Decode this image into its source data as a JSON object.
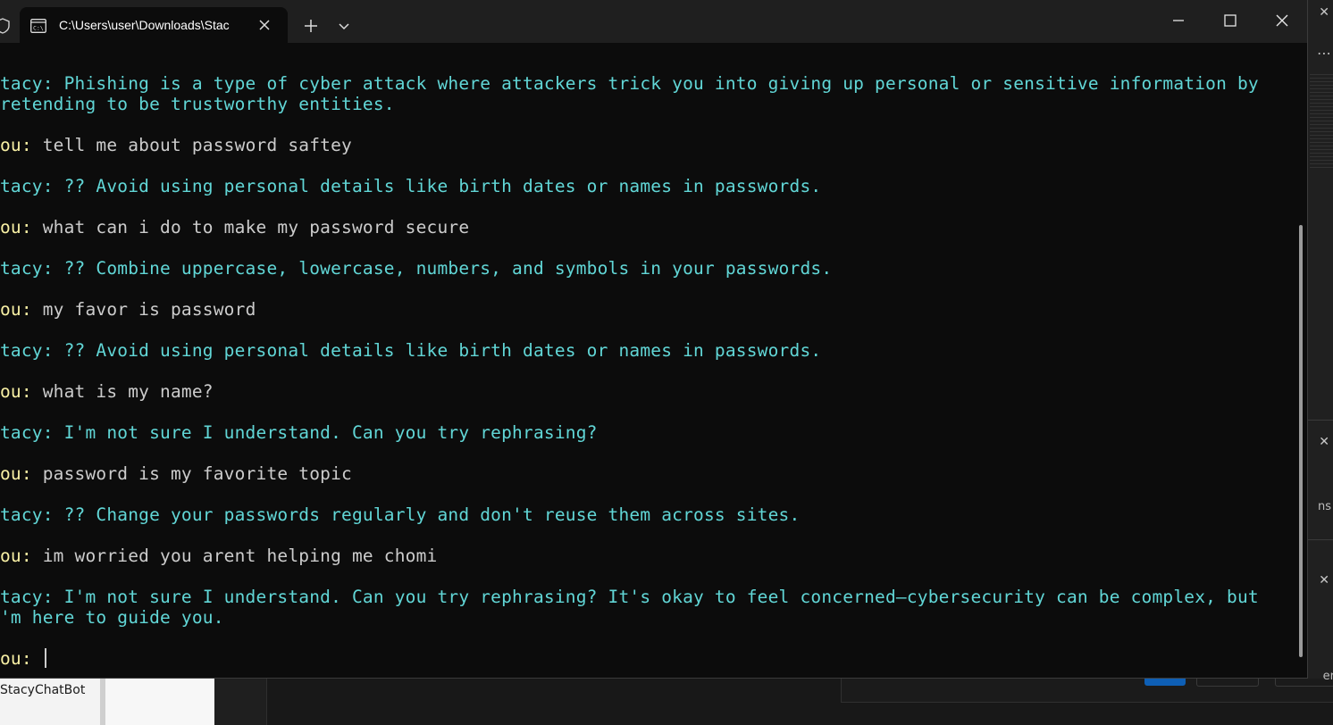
{
  "window": {
    "tab_title": "C:\\Users\\user\\Downloads\\Stac",
    "tab_icon": "command-prompt-icon"
  },
  "conversation": [
    {
      "speaker": "bot",
      "text": "Stacy: Phishing is a type of cyber attack where attackers trick you into giving up personal or sensitive information by\npretending to be trustworthy entities."
    },
    {
      "speaker": "user",
      "label": "You:",
      "text": " tell me about password saftey"
    },
    {
      "speaker": "bot",
      "text": "Stacy: ?? Avoid using personal details like birth dates or names in passwords."
    },
    {
      "speaker": "user",
      "label": "You:",
      "text": " what can i do to make my password secure"
    },
    {
      "speaker": "bot",
      "text": "Stacy: ?? Combine uppercase, lowercase, numbers, and symbols in your passwords."
    },
    {
      "speaker": "user",
      "label": "You:",
      "text": " my favor is password"
    },
    {
      "speaker": "bot",
      "text": "Stacy: ?? Avoid using personal details like birth dates or names in passwords."
    },
    {
      "speaker": "user",
      "label": "You:",
      "text": " what is my name?"
    },
    {
      "speaker": "bot",
      "text": "Stacy: I'm not sure I understand. Can you try rephrasing?"
    },
    {
      "speaker": "user",
      "label": "You:",
      "text": " password is my favorite topic"
    },
    {
      "speaker": "bot",
      "text": "Stacy: ?? Change your passwords regularly and don't reuse them across sites."
    },
    {
      "speaker": "user",
      "label": "You:",
      "text": " im worried you arent helping me chomi"
    },
    {
      "speaker": "bot",
      "text": "Stacy: I'm not sure I understand. Can you try rephrasing? It's okay to feel concerned—cybersecurity can be complex, but\nI'm here to guide you."
    },
    {
      "speaker": "user",
      "label": "You:",
      "text": " "
    }
  ],
  "background": {
    "file_label": "StacyChatBot",
    "right_text_1": "ns",
    "right_text_2": "er"
  },
  "colors": {
    "terminal_bg": "#0c0c0c",
    "bot_text": "#61d6d6",
    "you_label": "#f9f1a5",
    "user_text": "#cccccc",
    "titlebar": "#1f1f1f"
  }
}
